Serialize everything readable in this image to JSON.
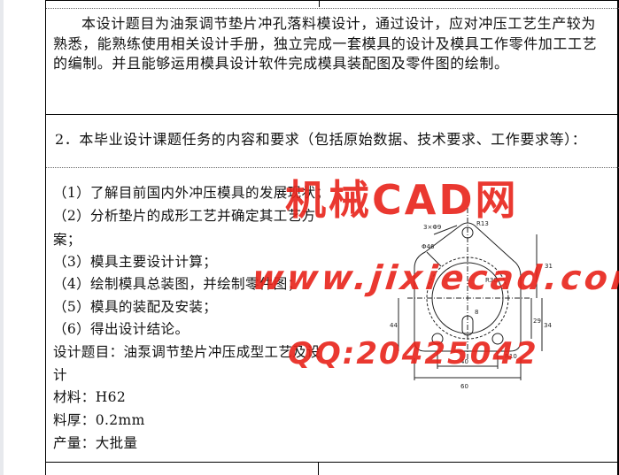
{
  "intro": {
    "text": "本设计题目为油泵调节垫片冲孔落料模设计，通过设计，应对冲压工艺生产较为熟悉，能熟练使用相关设计手册，独立完成一套模具的设计及模具工作零件加工工艺的编制。并且能够运用模具设计软件完成模具装配图及零件图的绘制。"
  },
  "section2": {
    "heading": "2．本毕业设计课题任务的内容和要求（包括原始数据、技术要求、工作要求等）："
  },
  "tasks": [
    "（1）了解目前国内外冲压模具的发展现状；",
    "（2）分析垫片的成形工艺并确定其工艺方",
    "案；",
    "（3）模具主要设计计算；",
    "（4）绘制模具总装图，并绘制零件图；",
    "（5）模具的装配及安装；",
    "（6）得出设计结论。"
  ],
  "design_info": {
    "topic_line1": "设计题目：油泵调节垫片冲压成型工艺及设",
    "topic_line2": "计",
    "material": "材料：H62",
    "thickness": "料厚：0.2mm",
    "volume": "产量：大批量"
  },
  "drawing_dims": {
    "holes": "3×Φ9",
    "r13": "R13",
    "dia46": "Φ46",
    "r30": "R30",
    "r10": "R10",
    "d31": "31",
    "d29": "29",
    "d34": "34",
    "d44": "44",
    "d40": "40",
    "d60": "60",
    "d8": "8"
  },
  "watermark": {
    "line1": "机械CAD网",
    "line2": "www.jixiecad.com",
    "line3": "QQ:20425042"
  },
  "colors": {
    "watermark": "#e8231a",
    "rule": "#000000"
  }
}
